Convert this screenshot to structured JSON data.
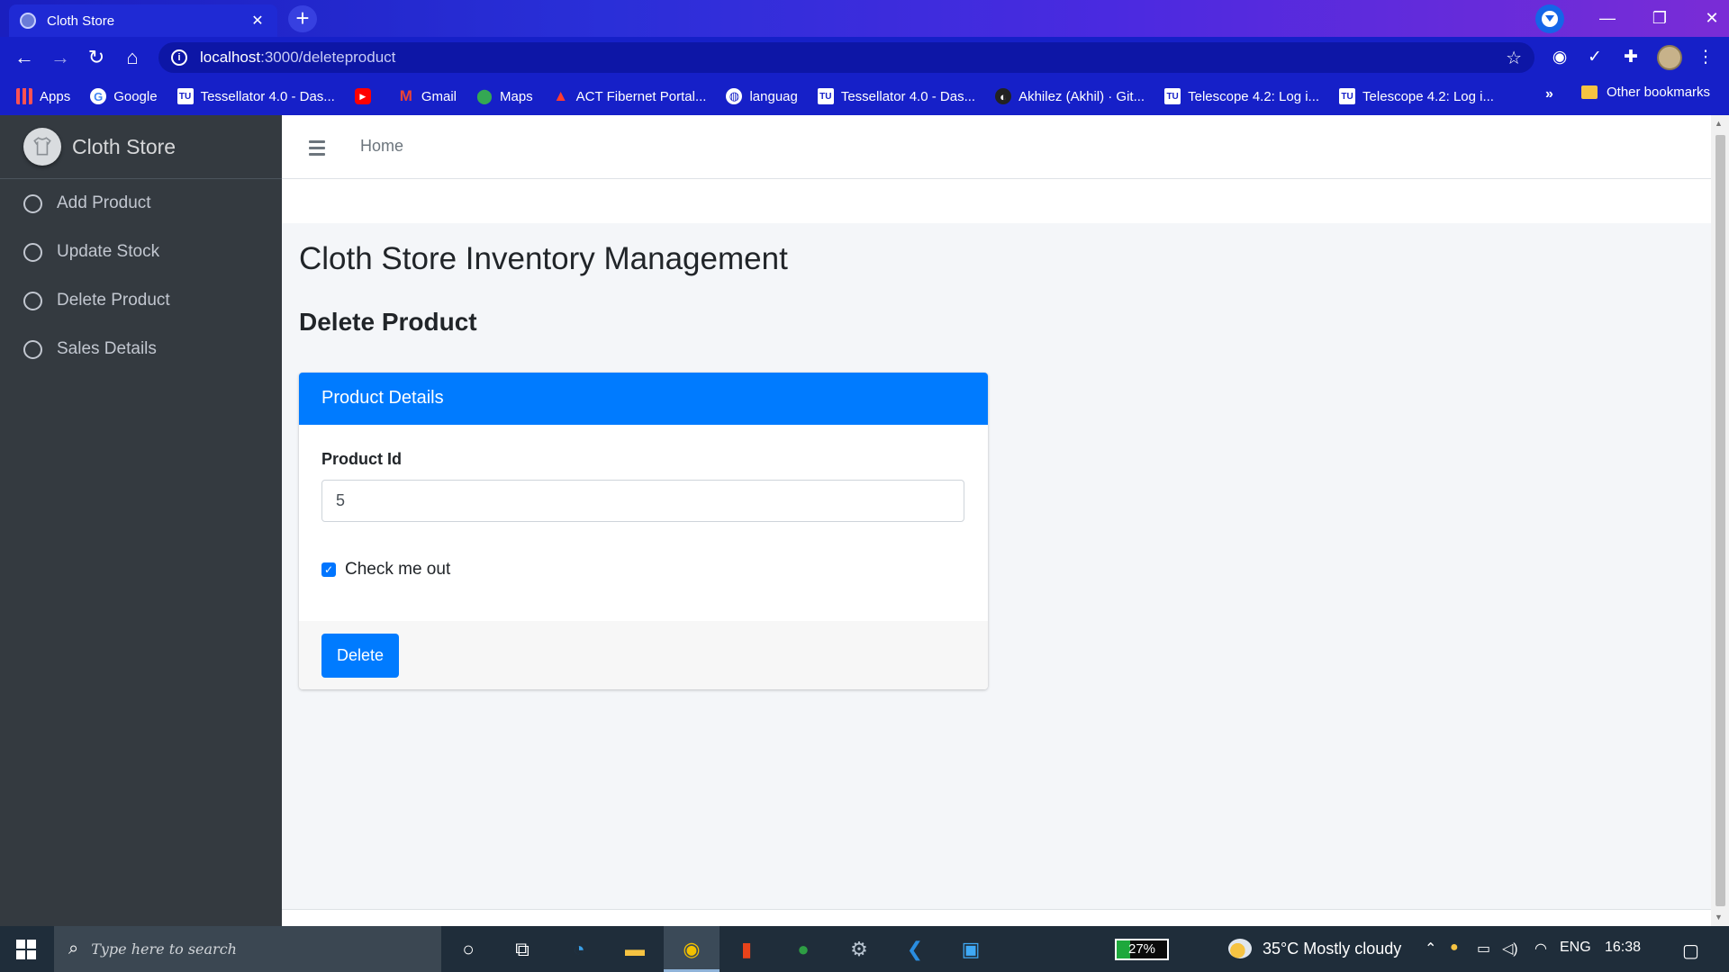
{
  "browser": {
    "tab_title": "Cloth Store",
    "tab_close": "✕",
    "new_tab": "+",
    "url_host": "localhost",
    "url_path": ":3000/deleteproduct",
    "bookmarks": [
      {
        "label": "Apps",
        "icon": "apps-grid-icon"
      },
      {
        "label": "Google",
        "icon": "google-icon"
      },
      {
        "label": "Tessellator 4.0 - Das...",
        "icon": "tu-icon"
      },
      {
        "label": "",
        "icon": "youtube-icon"
      },
      {
        "label": "Gmail",
        "icon": "gmail-icon"
      },
      {
        "label": "Maps",
        "icon": "maps-icon"
      },
      {
        "label": "ACT Fibernet Portal...",
        "icon": "act-icon"
      },
      {
        "label": "languag",
        "icon": "globe-icon"
      },
      {
        "label": "Tessellator 4.0 - Das...",
        "icon": "tu-icon"
      },
      {
        "label": "Akhilez (Akhil) · Git...",
        "icon": "github-icon"
      },
      {
        "label": "Telescope 4.2: Log i...",
        "icon": "tu-icon"
      },
      {
        "label": "Telescope 4.2: Log i...",
        "icon": "tu-icon"
      }
    ],
    "more_bookmarks": "»",
    "other_bookmarks": "Other bookmarks"
  },
  "sidebar": {
    "brand": "Cloth Store",
    "items": [
      {
        "label": "Add Product"
      },
      {
        "label": "Update Stock"
      },
      {
        "label": "Delete Product"
      },
      {
        "label": "Sales Details"
      }
    ]
  },
  "topnav": {
    "home": "Home"
  },
  "main": {
    "title": "Cloth Store Inventory Management",
    "subtitle": "Delete Product",
    "card": {
      "header": "Product Details",
      "field_label": "Product Id",
      "field_value": "5",
      "checkbox_label": "Check me out",
      "checkbox_checked": true,
      "button": "Delete"
    }
  },
  "taskbar": {
    "search_placeholder": "Type here to search",
    "battery": "27%",
    "weather": "35°C  Mostly cloudy",
    "lang": "ENG",
    "time": "16:38"
  },
  "colors": {
    "primary": "#007bff",
    "sidebar": "#343a40",
    "browser": "#1620c8"
  }
}
